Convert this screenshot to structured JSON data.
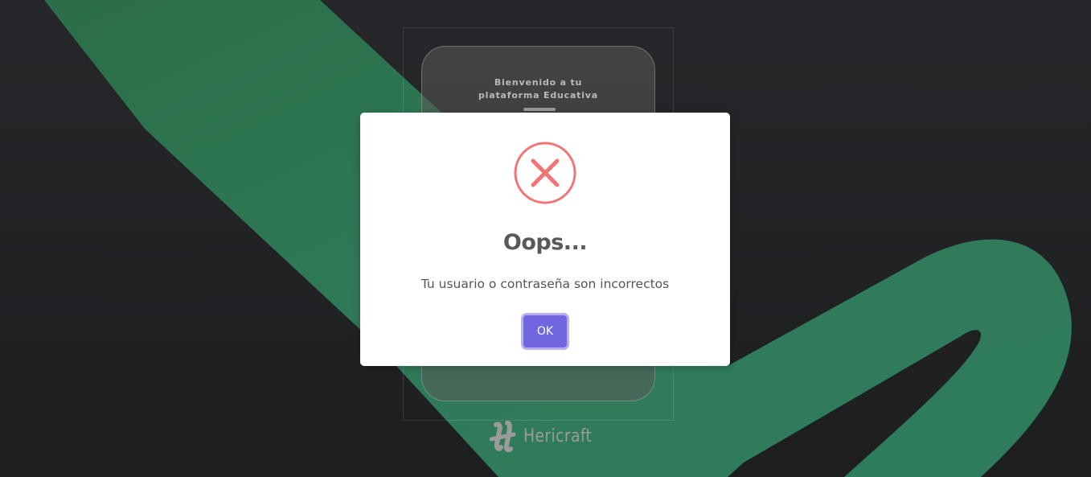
{
  "background": {
    "base_color": "#222326",
    "accent_color": "#2e7c5a"
  },
  "login_card": {
    "welcome_line1": "Bienvenido a tu",
    "welcome_line2": "plataforma Educativa"
  },
  "brand": {
    "name": "Hericraft",
    "logo_icon": "hericraft-logo-icon"
  },
  "alert": {
    "icon": "error-x-icon",
    "icon_color": "#f27474",
    "title": "Oops...",
    "message": "Tu usuario o contraseña son incorrectos",
    "confirm_label": "OK",
    "confirm_color": "#7066e0"
  }
}
